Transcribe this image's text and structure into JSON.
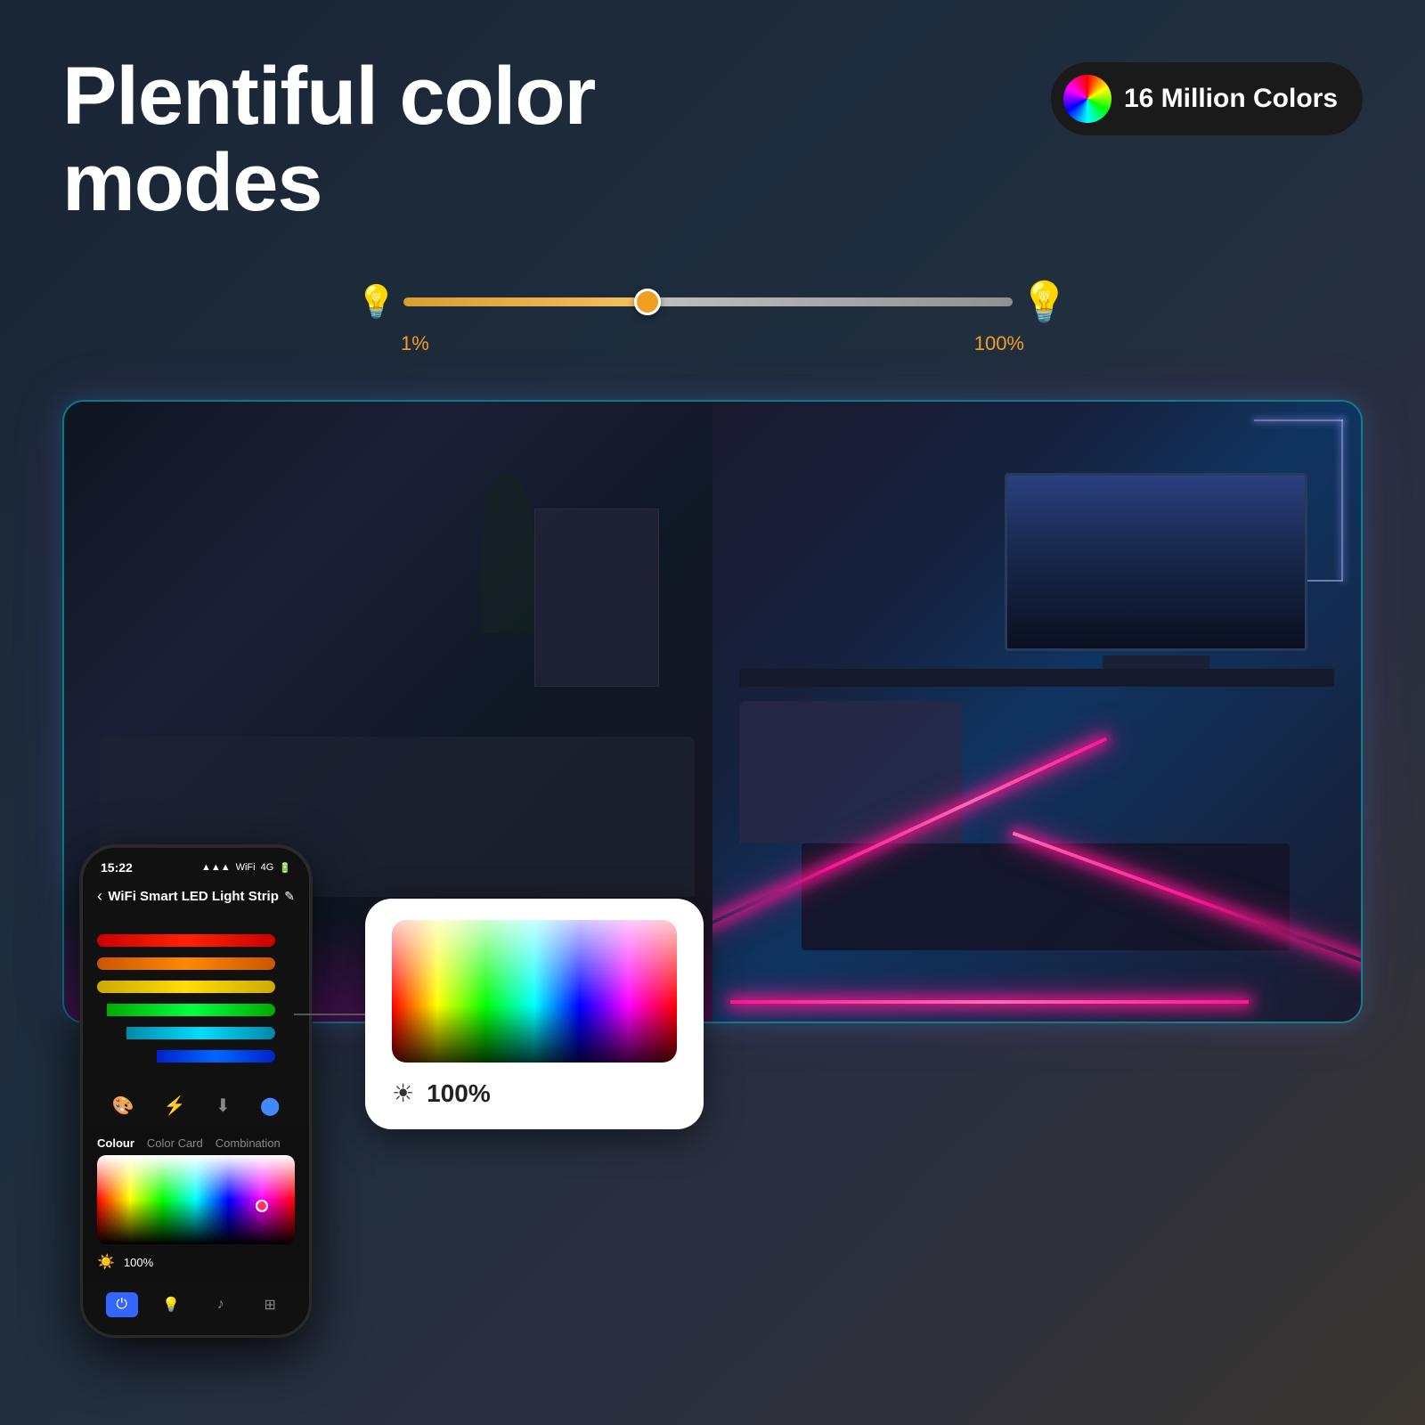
{
  "header": {
    "title": "Plentiful color modes",
    "badge_text": "16 Million Colors"
  },
  "slider": {
    "left_label": "1%",
    "right_label": "100%"
  },
  "phone": {
    "time": "15:22",
    "signal": "4G",
    "app_title": "WiFi Smart LED Light Strip",
    "edit_label": "✎",
    "tabs": [
      "Colour",
      "Color Card",
      "Combination"
    ],
    "active_tab": "Colour",
    "brightness_label": "100%"
  },
  "color_picker": {
    "brightness_label": "100%"
  }
}
